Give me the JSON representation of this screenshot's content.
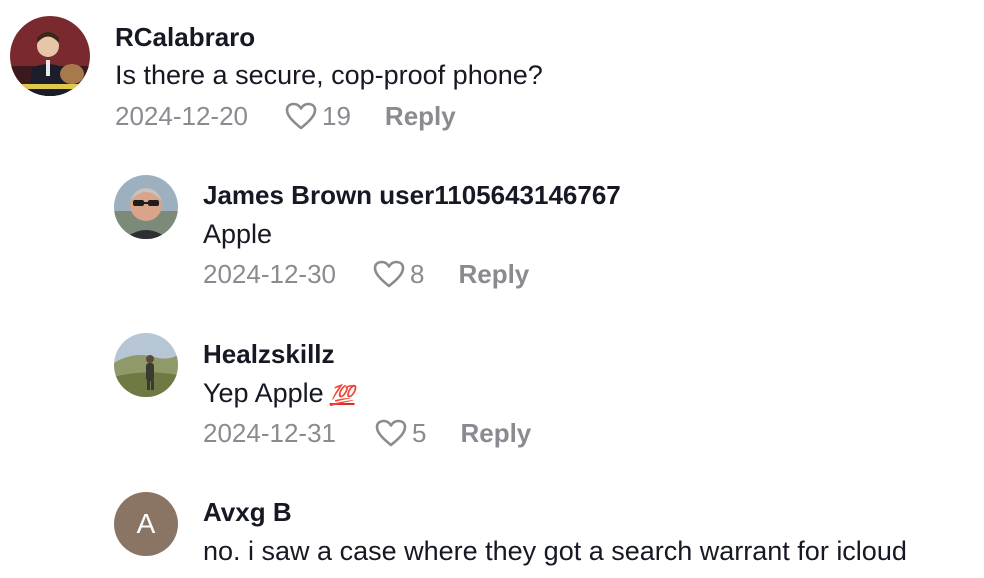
{
  "comments": [
    {
      "username": "RCalabraro",
      "text": "Is there a secure, cop-proof phone?",
      "date": "2024-12-20",
      "likes": "19",
      "reply_label": "Reply",
      "avatar_icon": "user-photo-avatar"
    },
    {
      "username": "James Brown user1105643146767",
      "text": "Apple",
      "date": "2024-12-30",
      "likes": "8",
      "reply_label": "Reply",
      "avatar_icon": "user-photo-avatar"
    },
    {
      "username": "Healzskillz",
      "text": "Yep Apple",
      "emoji": "💯",
      "date": "2024-12-31",
      "likes": "5",
      "reply_label": "Reply",
      "avatar_icon": "user-photo-avatar"
    },
    {
      "username": "Avxg B",
      "text": "no. i saw a case where they got a search warrant for icloud",
      "avatar_initial": "A"
    }
  ],
  "colors": {
    "username": "#161823",
    "meta": "#8a8b91",
    "initial_avatar": "#8a7565"
  }
}
